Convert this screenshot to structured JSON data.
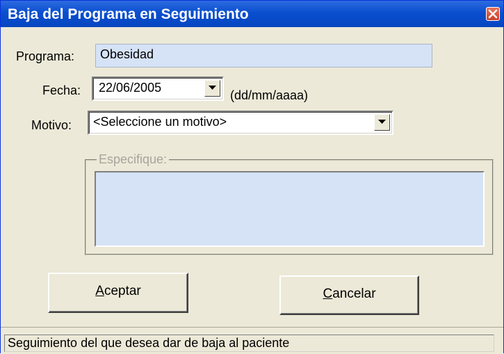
{
  "window": {
    "title": "Baja del Programa en Seguimiento"
  },
  "form": {
    "programa_label": "Programa:",
    "programa_value": "Obesidad",
    "fecha_label": "Fecha:",
    "fecha_value": "22/06/2005",
    "fecha_hint": "(dd/mm/aaaa)",
    "motivo_label": "Motivo:",
    "motivo_value": "<Seleccione un motivo>",
    "especifique_label": "Especifique:",
    "especifique_value": ""
  },
  "buttons": {
    "aceptar": "Aceptar",
    "cancelar": "Cancelar"
  },
  "status": {
    "text": "Seguimiento del que desea dar de baja al paciente"
  },
  "colors": {
    "title_bar": "#0a4fcf",
    "dialog_bg": "#ece9d8",
    "readonly_field": "#d6e3f7",
    "close_button": "#c8402a"
  },
  "icons": {
    "close": "close-icon",
    "dropdown": "chevron-down-icon"
  }
}
